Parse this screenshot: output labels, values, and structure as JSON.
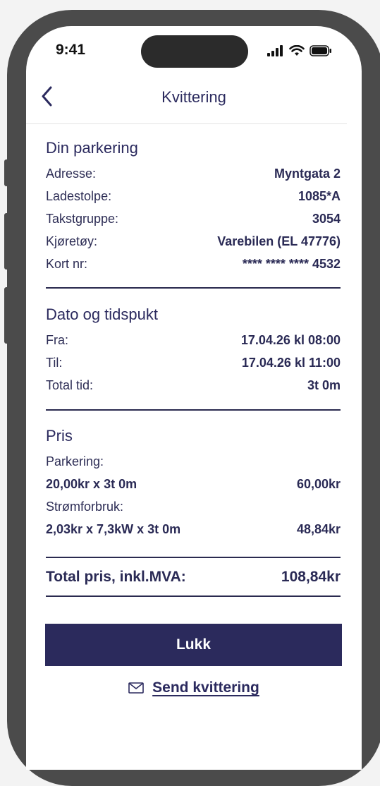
{
  "status_bar": {
    "time": "9:41"
  },
  "header": {
    "title": "Kvittering"
  },
  "parking": {
    "title": "Din parkering",
    "rows": [
      {
        "label": "Adresse:",
        "value": "Myntgata 2"
      },
      {
        "label": "Ladestolpe:",
        "value": "1085*A"
      },
      {
        "label": "Takstgruppe:",
        "value": "3054"
      },
      {
        "label": "Kjøretøy:",
        "value": "Varebilen (EL 47776)"
      },
      {
        "label": "Kort nr:",
        "value": "**** **** **** 4532"
      }
    ]
  },
  "datetime": {
    "title": "Dato og tidspukt",
    "rows": [
      {
        "label": "Fra:",
        "value": "17.04.26 kl 08:00"
      },
      {
        "label": "Til:",
        "value": "17.04.26 kl 11:00"
      },
      {
        "label": "Total tid:",
        "value": "3t 0m"
      }
    ]
  },
  "price": {
    "title": "Pris",
    "parking_label": "Parkering:",
    "parking_calc": "20,00kr x 3t 0m",
    "parking_amount": "60,00kr",
    "power_label": "Strømforbruk:",
    "power_calc": "2,03kr x 7,3kW x 3t 0m",
    "power_amount": "48,84kr"
  },
  "total": {
    "label": "Total pris, inkl.MVA:",
    "value": "108,84kr"
  },
  "actions": {
    "close_label": "Lukk",
    "send_label": "Send kvittering"
  },
  "icons": {
    "back": "chevron-left-icon",
    "send": "envelope-icon"
  },
  "colors": {
    "primary": "#2b2a5c",
    "text": "#2a2a55",
    "frame": "#4b4b4b"
  }
}
